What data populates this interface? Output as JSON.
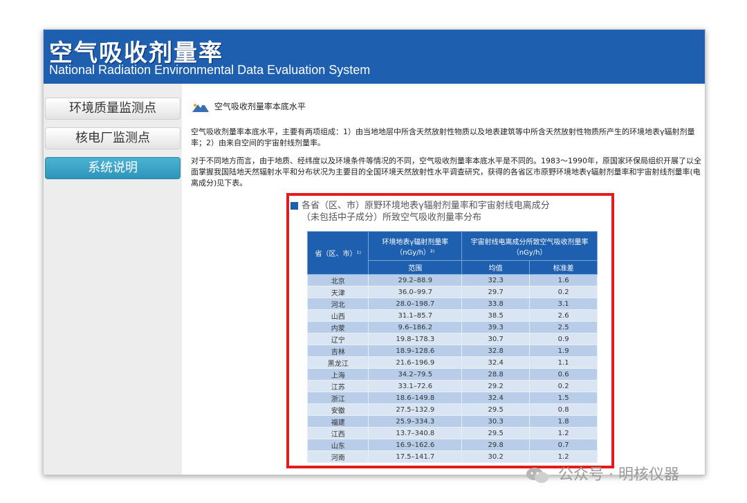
{
  "header": {
    "title": "空气吸收剂量率",
    "subtitle": "National Radiation Environmental Data Evaluation System"
  },
  "sidebar": {
    "items": [
      {
        "label": "环境质量监测点"
      },
      {
        "label": "核电厂监测点"
      },
      {
        "label": "系统说明"
      }
    ]
  },
  "main": {
    "section_title": "空气吸收剂量率本底水平",
    "para1": "空气吸收剂量率本底水平，主要有两项组成：1）由当地地层中所含天然放射性物质以及地表建筑等中所含天然放射性物质所产生的环境地表γ辐射剂量率；2）由来自空间的宇宙射线剂量率。",
    "para2": "对于不同地方而言，由于地质、经纬度以及环境条件等情况的不同，空气吸收剂量率本底水平是不同的。1983～1990年，原国家环保局组织开展了以全面掌握我国陆地天然辐射水平和分布状况为主要目的全国环境天然放射性水平调查研究，获得的各省区市原野环境地表γ辐射剂量率和宇宙射线剂量率(电离成分)见下表。"
  },
  "figure": {
    "title_line1": "各省（区、市）原野环境地表γ辐射剂量率和宇宙射线电离成分",
    "title_line2": "（未包括中子成分）所致空气吸收剂量率分布",
    "table": {
      "col_province": "省（区、市）¹⁾",
      "col_gamma": "环境地表γ辐射剂量率（nGy/h）²⁾",
      "col_cosmic": "宇宙射线电离成分所致空气吸收剂量率（nGy/h）",
      "sub_range": "范围",
      "sub_mean": "均值",
      "sub_std": "标准差",
      "rows": [
        {
          "province": "北京",
          "range": "29.2–88.9",
          "mean": "32.3",
          "std": "1.6"
        },
        {
          "province": "天津",
          "range": "36.0–99.7",
          "mean": "29.7",
          "std": "0.2"
        },
        {
          "province": "河北",
          "range": "28.0–198.7",
          "mean": "33.8",
          "std": "3.1"
        },
        {
          "province": "山西",
          "range": "31.1–85.7",
          "mean": "38.5",
          "std": "2.6"
        },
        {
          "province": "内蒙",
          "range": "9.6–186.2",
          "mean": "39.3",
          "std": "2.5"
        },
        {
          "province": "辽宁",
          "range": "19.8–178.3",
          "mean": "30.7",
          "std": "0.9"
        },
        {
          "province": "吉林",
          "range": "18.9–128.6",
          "mean": "32.8",
          "std": "1.9"
        },
        {
          "province": "黑龙江",
          "range": "21.6–196.9",
          "mean": "32.4",
          "std": "1.1"
        },
        {
          "province": "上海",
          "range": "34.2–79.5",
          "mean": "28.8",
          "std": "0.6"
        },
        {
          "province": "江苏",
          "range": "33.1–72.6",
          "mean": "29.2",
          "std": "0.2"
        },
        {
          "province": "浙江",
          "range": "18.6–149.8",
          "mean": "32.4",
          "std": "1.5"
        },
        {
          "province": "安徽",
          "range": "27.5–132.9",
          "mean": "29.5",
          "std": "0.8"
        },
        {
          "province": "福建",
          "range": "25.9–334.3",
          "mean": "30.3",
          "std": "1.8"
        },
        {
          "province": "江西",
          "range": "13.7–340.8",
          "mean": "29.5",
          "std": "1.2"
        },
        {
          "province": "山东",
          "range": "16.9–162.6",
          "mean": "29.8",
          "std": "0.7"
        },
        {
          "province": "河南",
          "range": "17.5–141.7",
          "mean": "30.2",
          "std": "1.2"
        }
      ]
    }
  },
  "watermark": "公众号 · 明核仪器"
}
